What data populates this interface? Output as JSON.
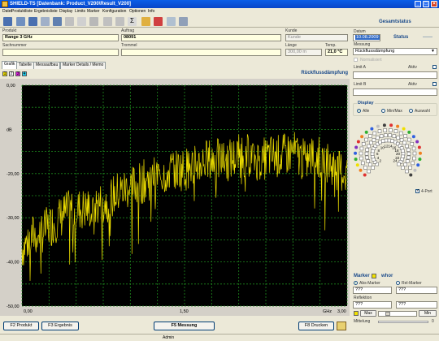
{
  "window": {
    "title": "SHIELD-TS [Datenbank: Product_V200\\Result_V200]"
  },
  "menu": [
    "Datei",
    "Produktliste",
    "Ergebnisliste",
    "Display",
    "Limits",
    "Marker",
    "Konfiguration",
    "Optionen",
    "Info"
  ],
  "status_header": "Gesamtstatus",
  "form": {
    "produkt": {
      "label": "Produkt",
      "value": "Range 3 GHz"
    },
    "auftrag": {
      "label": "Auftrag",
      "value": "08091"
    },
    "kunde": {
      "label": "Kunde",
      "value": "Kunde"
    },
    "datum": {
      "label": "Datum",
      "value": "10.08.2009"
    },
    "status": {
      "label": "Status",
      "value": "------"
    },
    "sachnummer": {
      "label": "Sachnummer",
      "value": ""
    },
    "trommel": {
      "label": "Trommel",
      "value": ""
    },
    "laenge": {
      "label": "Länge",
      "value": "300,00 m"
    },
    "temp": {
      "label": "Temp.",
      "value": "21,0 °C"
    },
    "messung": {
      "label": "Messung",
      "value": "Rückflussdämpfung"
    },
    "normalisiert": "Normalisiert"
  },
  "tabs": [
    "Grafik",
    "Tabelle",
    "Messaufbau",
    "Marker Details / Memo"
  ],
  "color_buttons": [
    {
      "label": "1",
      "color": "#f0e000"
    },
    {
      "label": "2",
      "color": "#ffffff"
    },
    {
      "label": "3",
      "color": "#e020e0"
    },
    {
      "label": "4",
      "color": "#20d0f0"
    }
  ],
  "chart_title": "Rückflussdämpfung",
  "chart_data": {
    "type": "line",
    "title": "Rückflussdämpfung",
    "ylabel": "dB",
    "xlabel": "GHz",
    "xlim": [
      0,
      3
    ],
    "ylim": [
      -50,
      0
    ],
    "y_ticks": [
      "0,00",
      "dB",
      "-20,00",
      "-30,00",
      "-40,00",
      "-50,00"
    ],
    "y_tick_values": [
      0,
      -10,
      -20,
      -30,
      -40,
      -50
    ],
    "x_ticks": [
      "0,00",
      "1,50",
      "3,00"
    ],
    "x_tick_values": [
      0,
      1.5,
      3
    ],
    "grid": true,
    "series": [
      {
        "color": "#f0e000",
        "x": [
          0.0,
          0.1,
          0.2,
          0.3,
          0.4,
          0.5,
          0.6,
          0.7,
          0.8,
          0.9,
          1.0,
          1.1,
          1.2,
          1.3,
          1.4,
          1.5,
          1.6,
          1.7,
          1.8,
          1.9,
          2.0,
          2.1,
          2.2,
          2.3,
          2.4,
          2.5,
          2.6,
          2.7,
          2.8,
          2.9,
          3.0
        ],
        "y": [
          -37,
          -34,
          -33,
          -31,
          -29,
          -28,
          -28,
          -27,
          -26,
          -24,
          -23,
          -22,
          -21,
          -20,
          -19,
          -19,
          -18,
          -17,
          -17,
          -17,
          -16,
          -16,
          -17,
          -16,
          -16,
          -15,
          -17,
          -16,
          -17,
          -19,
          -20
        ]
      }
    ]
  },
  "limits": {
    "limit_a": {
      "label": "Limit A",
      "aktiv": "Aktiv",
      "value": ""
    },
    "limit_b": {
      "label": "Limit B",
      "aktiv": "Aktiv",
      "value": ""
    }
  },
  "display": {
    "title": "Display",
    "options": [
      "Alle",
      "Min/Max",
      "Auswahl"
    ],
    "selected": "Alle",
    "port_labels": [
      "2",
      "4",
      "6",
      "8",
      "10",
      "12",
      "14",
      "16",
      "18",
      "20",
      "22",
      "24"
    ],
    "four_port": "4-Port"
  },
  "marker": {
    "title": "Marker",
    "whor": "whor",
    "abs": "Abs-Marker",
    "rel": "Rel-Marker",
    "abs_value": "???",
    "rel_value": "???",
    "reflektion_label": "Reflektion",
    "reflektion_value": "???",
    "refl_value2": "???",
    "max_btn": "Max",
    "min_btn": "Min",
    "mittelung_label": "Mittelung",
    "mittelung_value": "0"
  },
  "bottom_buttons": {
    "f2": "F2 Produkt",
    "f3": "F3 Ergebnis",
    "f5": "F5 Messung",
    "f8": "F8 Drucken"
  },
  "statusbar": {
    "user": "Admin"
  }
}
